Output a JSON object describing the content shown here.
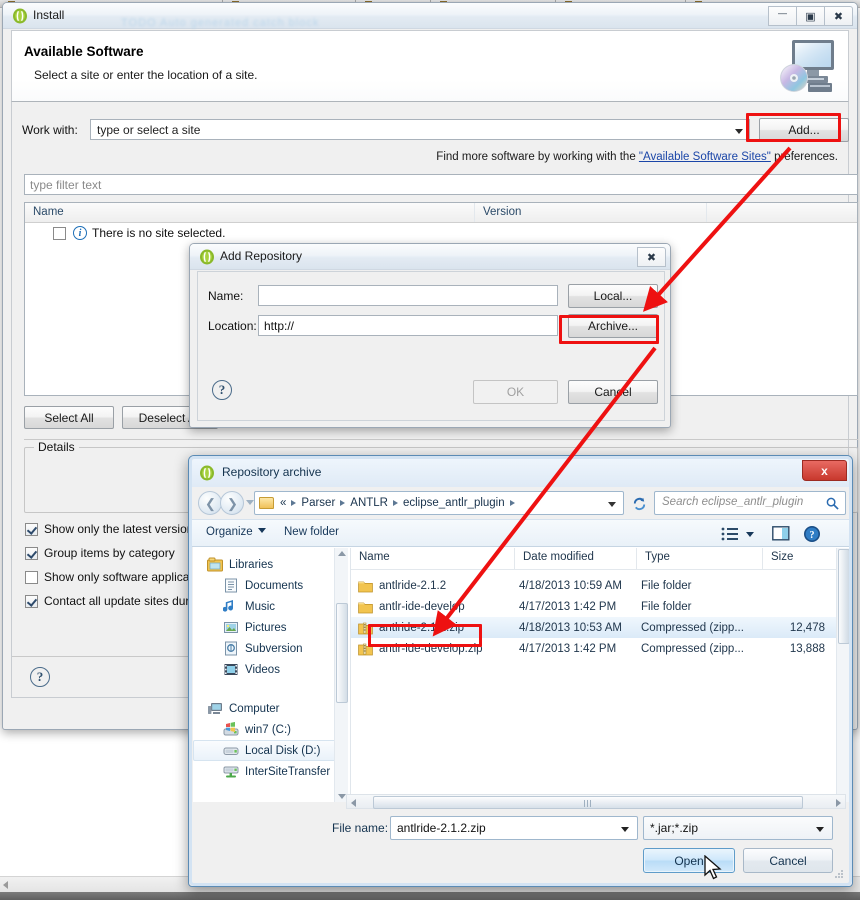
{
  "install_window": {
    "title": "Install",
    "ghost_text": "TODO Auto generated catch block",
    "window_buttons": {
      "minimize": "—",
      "maximize": "▣",
      "close": "✖"
    },
    "header": {
      "heading": "Available Software",
      "subheading": "Select a site or enter the location of a site.",
      "graphic": "install-computer-cd-icon"
    },
    "work_with": {
      "label": "Work with:",
      "value": "type or select a site",
      "add_button": "Add..."
    },
    "hint": {
      "prefix": "Find more software by working with the ",
      "link": "\"Available Software Sites\"",
      "suffix": " preferences."
    },
    "filter": {
      "placeholder": "type filter text"
    },
    "table": {
      "columns": [
        "Name",
        "Version",
        ""
      ],
      "empty_row": "There is no site selected."
    },
    "buttons": {
      "select_all": "Select All",
      "deselect_all": "Deselect All"
    },
    "details": {
      "legend": "Details",
      "value": ""
    },
    "options": [
      {
        "label": "Show only the latest versions of available software",
        "checked": true
      },
      {
        "label": "Group items by category",
        "checked": true
      },
      {
        "label": "Show only software applicable to target environment",
        "checked": false
      },
      {
        "label": "Contact all update sites during install to find required software",
        "checked": true
      }
    ],
    "help_icon": "?"
  },
  "add_repository": {
    "title": "Add Repository",
    "close_label": "✖",
    "fields": [
      {
        "label": "Name:",
        "value": ""
      },
      {
        "label": "Location:",
        "value": "http://"
      }
    ],
    "side_buttons": [
      "Local...",
      "Archive..."
    ],
    "footer_buttons": {
      "ok": "OK",
      "ok_disabled": true,
      "cancel": "Cancel"
    },
    "help_icon": "?"
  },
  "file_dialog": {
    "title": "Repository archive",
    "close_label": "x",
    "breadcrumb": {
      "overflow": "«",
      "parts": [
        "Parser",
        "ANTLR",
        "eclipse_antlr_plugin"
      ]
    },
    "search": {
      "placeholder": "Search eclipse_antlr_plugin",
      "icon": "search-icon"
    },
    "toolbar": {
      "organize": "Organize",
      "new_folder": "New folder",
      "view_icon": "view-list-icon",
      "preview_icon": "preview-pane-icon",
      "help_icon": "help-icon"
    },
    "sidebar": [
      {
        "label": "Libraries",
        "icon": "libraries-icon",
        "indent": 0,
        "selected": false
      },
      {
        "label": "Documents",
        "icon": "documents-icon",
        "indent": 1,
        "selected": false
      },
      {
        "label": "Music",
        "icon": "music-icon",
        "indent": 1,
        "selected": false
      },
      {
        "label": "Pictures",
        "icon": "pictures-icon",
        "indent": 1,
        "selected": false
      },
      {
        "label": "Subversion",
        "icon": "subversion-icon",
        "indent": 1,
        "selected": false
      },
      {
        "label": "Videos",
        "icon": "videos-icon",
        "indent": 1,
        "selected": false
      },
      {
        "label": "",
        "icon": "",
        "indent": 0,
        "selected": false
      },
      {
        "label": "Computer",
        "icon": "computer-icon",
        "indent": 0,
        "selected": false
      },
      {
        "label": "win7 (C:)",
        "icon": "hdd-windows-icon",
        "indent": 1,
        "selected": false
      },
      {
        "label": "Local Disk (D:)",
        "icon": "hdd-icon",
        "indent": 1,
        "selected": true
      },
      {
        "label": "InterSiteTransfer",
        "icon": "network-drive-icon",
        "indent": 1,
        "selected": false
      }
    ],
    "file_columns": [
      "Name",
      "Date modified",
      "Type",
      "Size"
    ],
    "files": [
      {
        "name": "antlride-2.1.2",
        "date": "4/18/2013 10:59 AM",
        "type": "File folder",
        "size": "",
        "icon": "folder-icon",
        "selected": false
      },
      {
        "name": "antlr-ide-develop",
        "date": "4/17/2013 1:42 PM",
        "type": "File folder",
        "size": "",
        "icon": "folder-icon",
        "selected": false
      },
      {
        "name": "antlride-2.1.2.zip",
        "date": "4/18/2013 10:53 AM",
        "type": "Compressed (zipp...",
        "size": "12,478",
        "icon": "zip-icon",
        "selected": true
      },
      {
        "name": "antlr-ide-develop.zip",
        "date": "4/17/2013 1:42 PM",
        "type": "Compressed (zipp...",
        "size": "13,888",
        "icon": "zip-icon",
        "selected": false
      }
    ],
    "file_name": {
      "label": "File name:",
      "value": "antlride-2.1.2.zip"
    },
    "file_type": {
      "value": "*.jar;*.zip"
    },
    "buttons": {
      "open": "Open",
      "cancel": "Cancel"
    }
  },
  "annotations": {
    "highlight_color": "#ee1111",
    "highlights": [
      "add-button",
      "archive-button",
      "selected-zip-file"
    ],
    "arrows": [
      "add-to-archive-arrow",
      "archive-to-file-arrow"
    ]
  }
}
